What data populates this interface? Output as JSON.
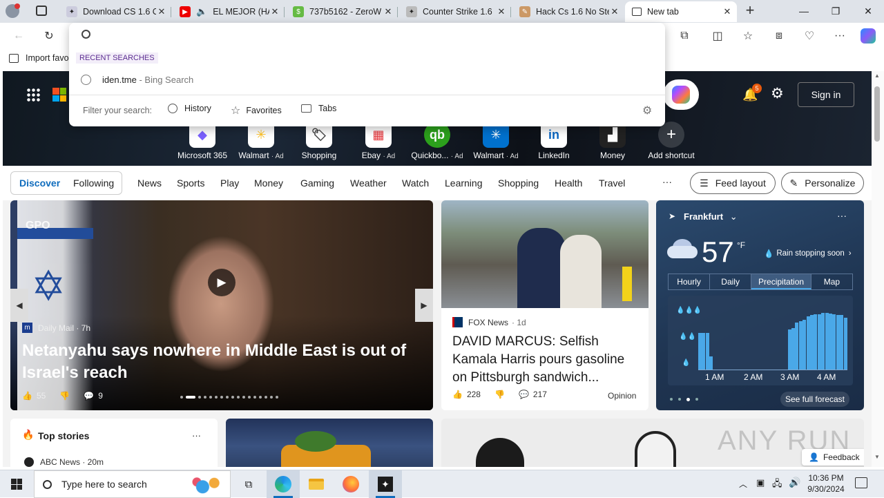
{
  "tabs": [
    {
      "title": "Download CS 1.6 C",
      "icon": "cs-icon"
    },
    {
      "title": "EL MEJOR (HA",
      "icon": "youtube-icon"
    },
    {
      "title": "737b5162 - ZeroW",
      "icon": "zerow-icon"
    },
    {
      "title": "Counter Strike 1.6",
      "icon": "cs-icon"
    },
    {
      "title": "Hack Cs 1.6 No Ste",
      "icon": "hack-icon"
    },
    {
      "title": "New tab",
      "icon": "newtab-icon"
    }
  ],
  "favorites_bar": {
    "import_label": "Import favo"
  },
  "dropdown": {
    "recent_label": "RECENT SEARCHES",
    "recent_item": "iden.tme",
    "recent_suffix": " - Bing Search",
    "filter_label": "Filter your search:",
    "filters": [
      "History",
      "Favorites",
      "Tabs"
    ]
  },
  "header": {
    "notification_count": "5",
    "sign_in": "Sign in"
  },
  "shortcuts": [
    {
      "label": "Microsoft 365",
      "ad": ""
    },
    {
      "label": "Walmart",
      "ad": "· Ad"
    },
    {
      "label": "Shopping",
      "ad": ""
    },
    {
      "label": "Ebay",
      "ad": "· Ad"
    },
    {
      "label": "Quickbo...",
      "ad": "· Ad"
    },
    {
      "label": "Walmart",
      "ad": "· Ad"
    },
    {
      "label": "LinkedIn",
      "ad": ""
    },
    {
      "label": "Money",
      "ad": ""
    },
    {
      "label": "Add shortcut",
      "ad": ""
    }
  ],
  "nav": {
    "discover": "Discover",
    "following": "Following",
    "items": [
      "News",
      "Sports",
      "Play",
      "Money",
      "Gaming",
      "Weather",
      "Watch",
      "Learning",
      "Shopping",
      "Health",
      "Travel"
    ],
    "more": "···",
    "feed_layout": "Feed layout",
    "personalize": "Personalize"
  },
  "main_story": {
    "logo": "GPO",
    "source": "Daily Mail · 7h",
    "headline": "Netanyahu says nowhere in Middle East is out of Israel's reach",
    "likes": "55",
    "comments": "9"
  },
  "second_story": {
    "source": "FOX News",
    "age": "· 1d",
    "headline": "DAVID MARCUS: Selfish Kamala Harris pours gasoline on Pittsburgh sandwich...",
    "likes": "228",
    "comments": "217",
    "tag": "Opinion"
  },
  "weather": {
    "city": "Frankfurt",
    "temp": "57",
    "unit": "°F",
    "status": "Rain stopping soon",
    "tabs": [
      "Hourly",
      "Daily",
      "Precipitation",
      "Map"
    ],
    "times": [
      "1 AM",
      "2 AM",
      "3 AM",
      "4 AM"
    ],
    "see_full": "See full forecast",
    "precip_levels": [
      0.55,
      0.55,
      0.55,
      0.2,
      0,
      0,
      0,
      0,
      0,
      0,
      0,
      0,
      0,
      0,
      0,
      0,
      0,
      0,
      0,
      0,
      0,
      0,
      0,
      0,
      0.6,
      0.62,
      0.7,
      0.72,
      0.75,
      0.8,
      0.82,
      0.83,
      0.83,
      0.85,
      0.85,
      0.84,
      0.83,
      0.82,
      0.82,
      0.78
    ]
  },
  "top_stories": {
    "title": "Top stories",
    "more": "···",
    "first_source": "ABC News · 20m"
  },
  "feedback": "Feedback",
  "watermark": "ANY RUN",
  "taskbar": {
    "search_placeholder": "Type here to search",
    "time": "10:36 PM",
    "date": "9/30/2024"
  },
  "colors": {
    "accent": "#0f6cbd",
    "chrome": "#dfe3e9",
    "bar": "#4aa8e8"
  }
}
